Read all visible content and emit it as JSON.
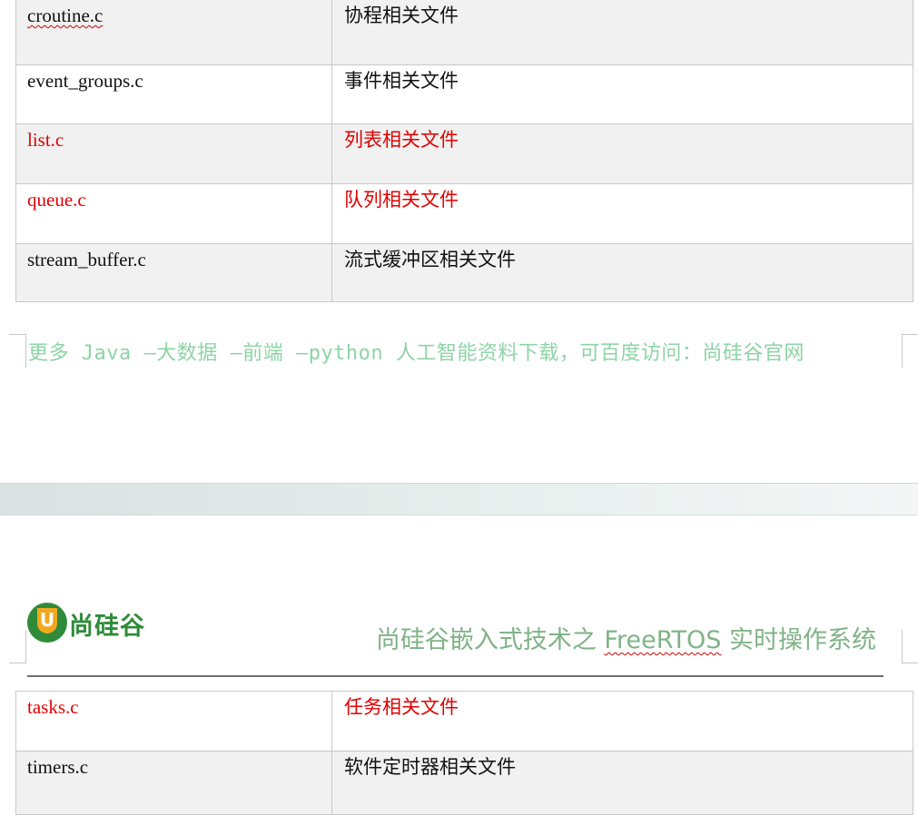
{
  "top_table": {
    "rows": [
      {
        "file": "croutine.c",
        "desc": "协程相关文件"
      },
      {
        "file": "event_groups.c",
        "desc": "事件相关文件"
      },
      {
        "file": "list.c",
        "desc": "列表相关文件"
      },
      {
        "file": "queue.c",
        "desc": "队列相关文件"
      },
      {
        "file": "stream_buffer.c",
        "desc": "流式缓冲区相关文件"
      }
    ]
  },
  "footer": {
    "text": "更多 Java –大数据 –前端 –python 人工智能资料下载，可百度访问：尚硅谷官网"
  },
  "header": {
    "logo_letter": "U",
    "logo_text": "尚硅谷",
    "title_prefix": "尚硅谷嵌入式技术之 ",
    "title_product": "FreeRTOS",
    "title_suffix": " 实时操作系统"
  },
  "bottom_table": {
    "rows": [
      {
        "file": "tasks.c",
        "desc": "任务相关文件"
      },
      {
        "file": "timers.c",
        "desc": "软件定时器相关文件"
      }
    ]
  },
  "colors": {
    "highlight_red": "#e10000",
    "footer_green": "#8dd4a6",
    "brand_green": "#2f8b3a",
    "brand_orange": "#f2a81d",
    "title_green": "#7fb386",
    "row_shade": "#f1f1f1"
  }
}
